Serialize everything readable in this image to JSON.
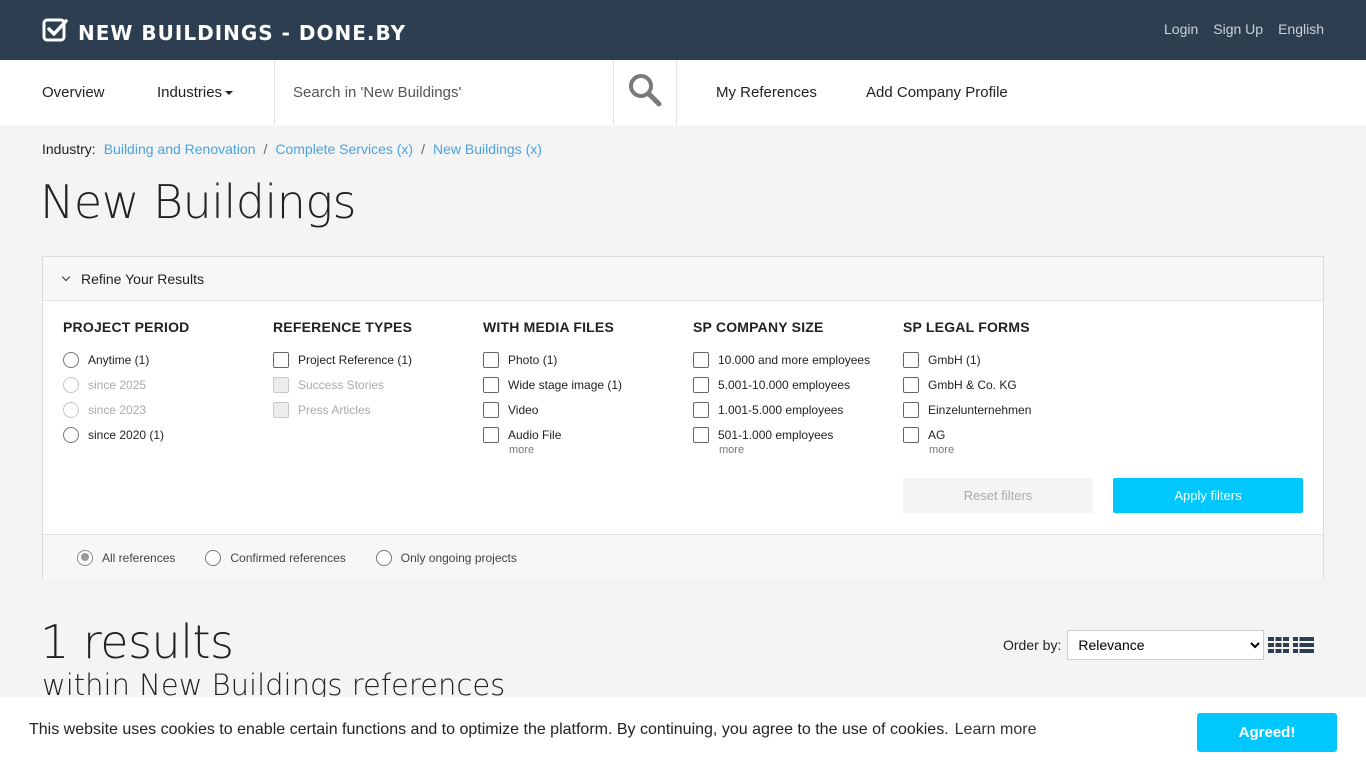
{
  "header": {
    "brand": "NEW BUILDINGS - DONE.BY",
    "links": [
      "Login",
      "Sign Up",
      "English"
    ]
  },
  "nav": {
    "overview": "Overview",
    "industries": "Industries",
    "search_placeholder": "Search in 'New Buildings'",
    "my_references": "My References",
    "add_company": "Add Company Profile"
  },
  "breadcrumb": {
    "label": "Industry:",
    "items": [
      "Building and Renovation",
      "Complete Services (x)",
      "New Buildings (x)"
    ],
    "sep": "/"
  },
  "page_title": "New Buildings",
  "filters": {
    "header": "Refine Your Results",
    "columns": [
      {
        "title": "PROJECT PERIOD",
        "options": [
          "Anytime (1)",
          "since 2025",
          "since 2023",
          "since 2020 (1)"
        ]
      },
      {
        "title": "REFERENCE TYPES",
        "options": [
          "Project Reference (1)",
          "Success Stories",
          "Press Articles"
        ]
      },
      {
        "title": "WITH MEDIA FILES",
        "options": [
          "Photo (1)",
          "Wide stage image (1)",
          "Video",
          "Audio File"
        ],
        "more": "more"
      },
      {
        "title": "SP COMPANY SIZE",
        "options": [
          "10.000 and more employees",
          "5.001-10.000 employees",
          "1.001-5.000 employees",
          "501-1.000 employees"
        ],
        "more": "more"
      },
      {
        "title": "SP LEGAL FORMS",
        "options": [
          "GmbH (1)",
          "GmbH & Co. KG",
          "Einzelunternehmen",
          "AG"
        ],
        "more": "more"
      }
    ],
    "reset": "Reset filters",
    "apply": "Apply filters",
    "scope": [
      "All references",
      "Confirmed references",
      "Only ongoing projects"
    ]
  },
  "results": {
    "count": "1 results",
    "sub": "within New Buildings references",
    "order_label": "Order by:",
    "order_value": "Relevance"
  },
  "cookie": {
    "text": "This website uses cookies to enable certain functions and to optimize the platform. By continuing, you agree to the use of cookies.",
    "learn": "Learn more",
    "button": "Agreed!"
  }
}
